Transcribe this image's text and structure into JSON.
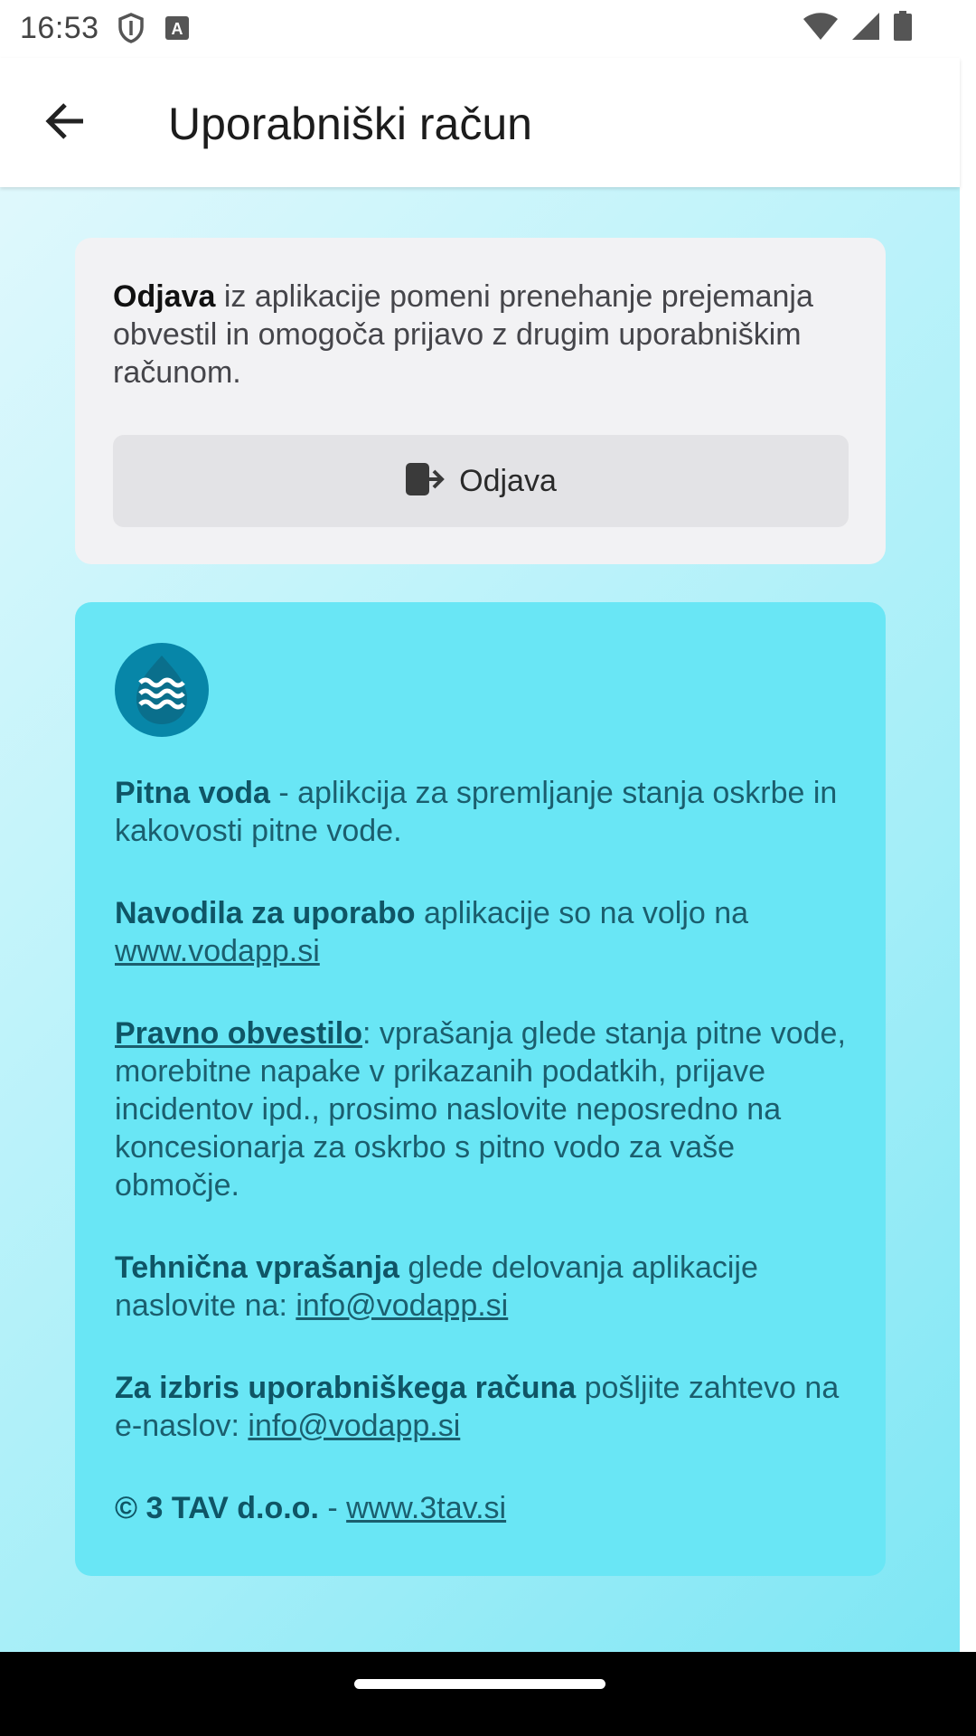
{
  "status_bar": {
    "time": "16:53",
    "icons": [
      "shield-icon",
      "font-a-icon",
      "wifi-icon",
      "signal-icon",
      "battery-icon"
    ]
  },
  "app_bar": {
    "title": "Uporabniški račun",
    "back_icon": "arrow-left-icon"
  },
  "logout_card": {
    "text_bold": "Odjava",
    "text_rest": " iz aplikacije pomeni prenehanje prejemanja obvestil in omogoča prijavo z drugim uporabniškim računom.",
    "button_label": "Odjava",
    "button_icon": "logout-icon"
  },
  "info_card": {
    "logo_icon": "water-drop-waves-icon",
    "p1_bold": "Pitna voda",
    "p1_rest": " - aplikcija za spremljanje stanja oskrbe in kakovosti pitne vode.",
    "p2_bold": "Navodila za uporabo",
    "p2_rest": " aplikacije so na voljo na ",
    "p2_link": "www.vodapp.si",
    "p3_link_bold": "Pravno obvestilo",
    "p3_rest": ": vprašanja glede stanja pitne vode, morebitne napake v prikazanih podatkih, prijave incidentov ipd., prosimo naslovite neposredno na koncesionarja za oskrbo s pitno vodo za vaše območje.",
    "p4_bold": "Tehnična vprašanja",
    "p4_rest": " glede delovanja aplikacije naslovite na: ",
    "p4_link": "info@vodapp.si",
    "p5_bold": "Za izbris uporabniškega računa",
    "p5_rest": " pošljite zahtevo na e-naslov: ",
    "p5_link": "info@vodapp.si",
    "p6_bold": "© 3 TAV d.o.o.",
    "p6_rest": " - ",
    "p6_link": "www.3tav.si"
  },
  "colors": {
    "info_card_bg": "#69e6f5",
    "info_text": "#1b5e6e",
    "logo_bg": "#0786a8"
  }
}
